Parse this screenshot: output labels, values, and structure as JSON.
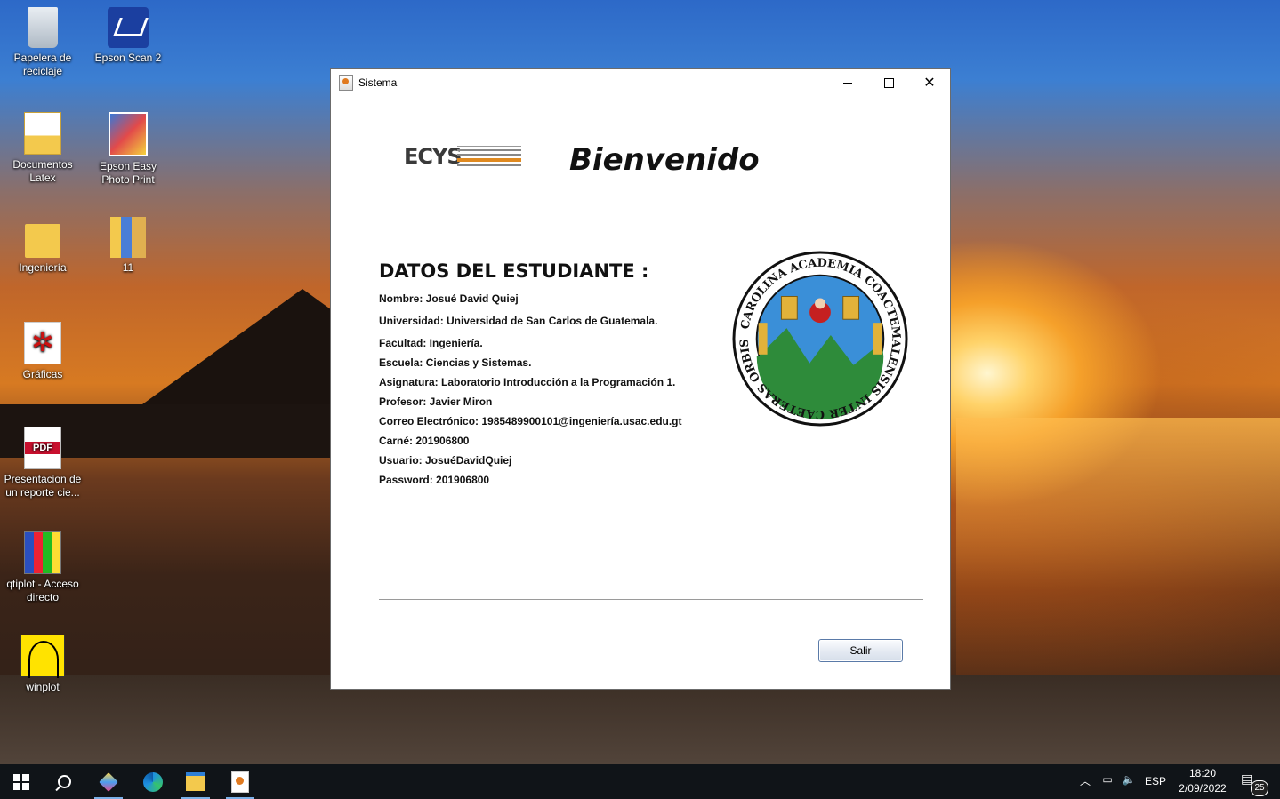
{
  "desktop": {
    "icons": [
      {
        "label": "Papelera de reciclaje",
        "icon": "recycle-bin-icon"
      },
      {
        "label": "Epson Scan 2",
        "icon": "scanner-icon"
      },
      {
        "label": "Documentos Latex",
        "icon": "folder-document-icon"
      },
      {
        "label": "Epson Easy Photo Print",
        "icon": "photo-print-icon"
      },
      {
        "label": "Ingeniería",
        "icon": "folder-icon"
      },
      {
        "label": "11",
        "icon": "folder-icon"
      },
      {
        "label": "Gráficas",
        "icon": "graphics-app-icon"
      },
      {
        "label": "Presentacion de un reporte cie...",
        "icon": "pdf-file-icon"
      },
      {
        "label": "qtiplot - Acceso directo",
        "icon": "qtiplot-icon"
      },
      {
        "label": "winplot",
        "icon": "winplot-icon"
      }
    ]
  },
  "window": {
    "title": "Sistema",
    "logo_text": "ECYS",
    "welcome": "Bienvenido",
    "heading": "DATOS DEL ESTUDIANTE :",
    "fields": [
      "Nombre: Josué David Quiej",
      "Universidad: Universidad de San Carlos de Guatemala.",
      "Facultad: Ingeniería.",
      "Escuela: Ciencias y Sistemas.",
      "Asignatura: Laboratorio Introducción a la Programación 1.",
      "Profesor: Javier Miron",
      "Correo Electrónico: 1985489900101@ingeniería.usac.edu.gt",
      "Carné: 201906800",
      "Usuario: JosuéDavidQuiej",
      "Password: 201906800"
    ],
    "seal_text": "CAROLINA ACADEMIA COACTEMALENSIS INTER CAETERAS ORBIS CONSPICUA",
    "exit_button": "Salir"
  },
  "taskbar": {
    "language": "ESP",
    "time": "18:20",
    "date": "2/09/2022",
    "notification_count": "25"
  },
  "colors": {
    "accent": "#e08a20",
    "taskbar": "#101418",
    "button_border": "#5a7aa8"
  }
}
